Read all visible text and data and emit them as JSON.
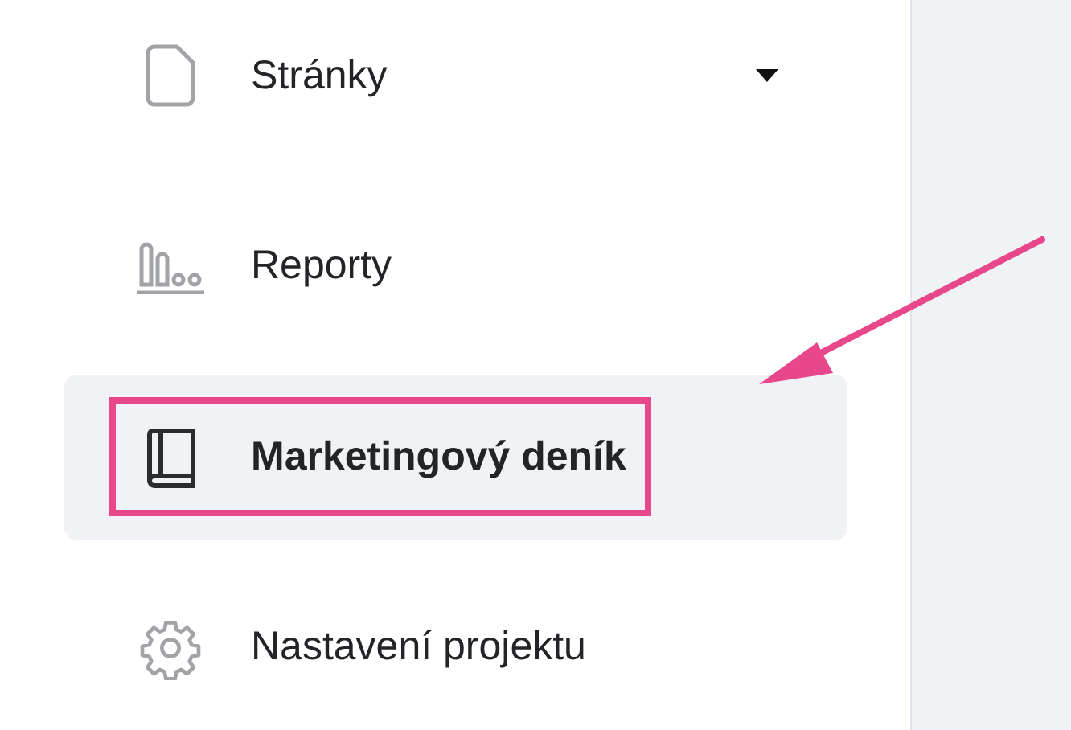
{
  "sidebar": {
    "items": [
      {
        "label": "Stránky",
        "kind": "dropdown",
        "selected": false,
        "highlighted": false
      },
      {
        "label": "Reporty",
        "kind": "link",
        "selected": false,
        "highlighted": false
      },
      {
        "label": "Marketingový deník",
        "kind": "link",
        "selected": true,
        "highlighted": true
      },
      {
        "label": "Nastavení projektu",
        "kind": "link",
        "selected": false,
        "highlighted": false
      }
    ]
  }
}
